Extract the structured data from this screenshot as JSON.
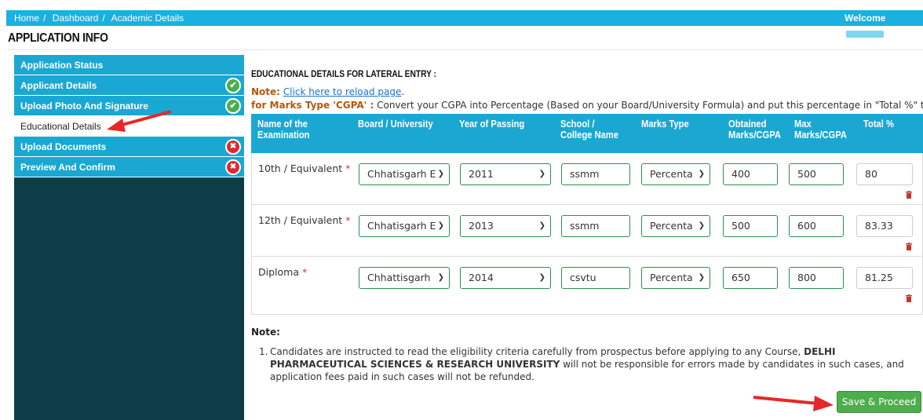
{
  "breadcrumb": {
    "items": [
      "Home",
      "Dashboard",
      "Academic Details"
    ],
    "welcome": "Welcome"
  },
  "page_title": "APPLICATION INFO",
  "sidebar": {
    "items": [
      {
        "label": "Application Status",
        "status": ""
      },
      {
        "label": "Applicant Details",
        "status": "check"
      },
      {
        "label": "Upload Photo And Signature",
        "status": "check"
      },
      {
        "label": "Educational Details",
        "status": "active"
      },
      {
        "label": "Upload Documents",
        "status": "cross"
      },
      {
        "label": "Preview And Confirm",
        "status": "cross"
      }
    ]
  },
  "section": {
    "title": "EDUCATIONAL DETAILS FOR LATERAL ENTRY :",
    "note_label": "Note:",
    "note_link": "Click here to reload page",
    "note_link_suffix": ".",
    "cgpa_label": "for Marks Type 'CGPA' :",
    "cgpa_text": " Convert your CGPA into Percentage (Based on your Board/University Formula) and put this percentage in \"Total %\" textbox."
  },
  "table": {
    "headers": [
      "Name of the Examination",
      "Board / University",
      "Year of Passing",
      "School / College Name",
      "Marks Type",
      "Obtained Marks/CGPA",
      "Max Marks/CGPA",
      "Total %"
    ],
    "rows": [
      {
        "exam": "10th / Equivalent",
        "required": "*",
        "board": "Chhatisgarh E",
        "year": "2011",
        "school": "ssmm",
        "marks_type": "Percenta",
        "obtained": "400",
        "max": "500",
        "total": "80"
      },
      {
        "exam": "12th / Equivalent",
        "required": "*",
        "board": "Chhatisgarh E",
        "year": "2013",
        "school": "ssmm",
        "marks_type": "Percenta",
        "obtained": "500",
        "max": "600",
        "total": "83.33"
      },
      {
        "exam": "Diploma",
        "required": "*",
        "board": "Chhattisgarh",
        "year": "2014",
        "school": "csvtu",
        "marks_type": "Percenta",
        "obtained": "650",
        "max": "800",
        "total": "81.25"
      }
    ]
  },
  "notes": {
    "title": "Note:",
    "item_number": "1.",
    "text_before": "Candidates are instructed to read the eligibility criteria carefully from prospectus before applying to any Course, ",
    "text_bold": "DELHI PHARMACEUTICAL SCIENCES & RESEARCH UNIVERSITY",
    "text_after": " will not be responsible for errors made by candidates in such cases, and application fees paid in such cases will not be refunded."
  },
  "actions": {
    "save_label": "Save & Proceed"
  },
  "colors": {
    "accent": "#1aa8d2",
    "sidebar_bg": "#0e3d49",
    "success": "#4cae4c",
    "danger": "#e0292d",
    "arrow": "#e8262a"
  }
}
